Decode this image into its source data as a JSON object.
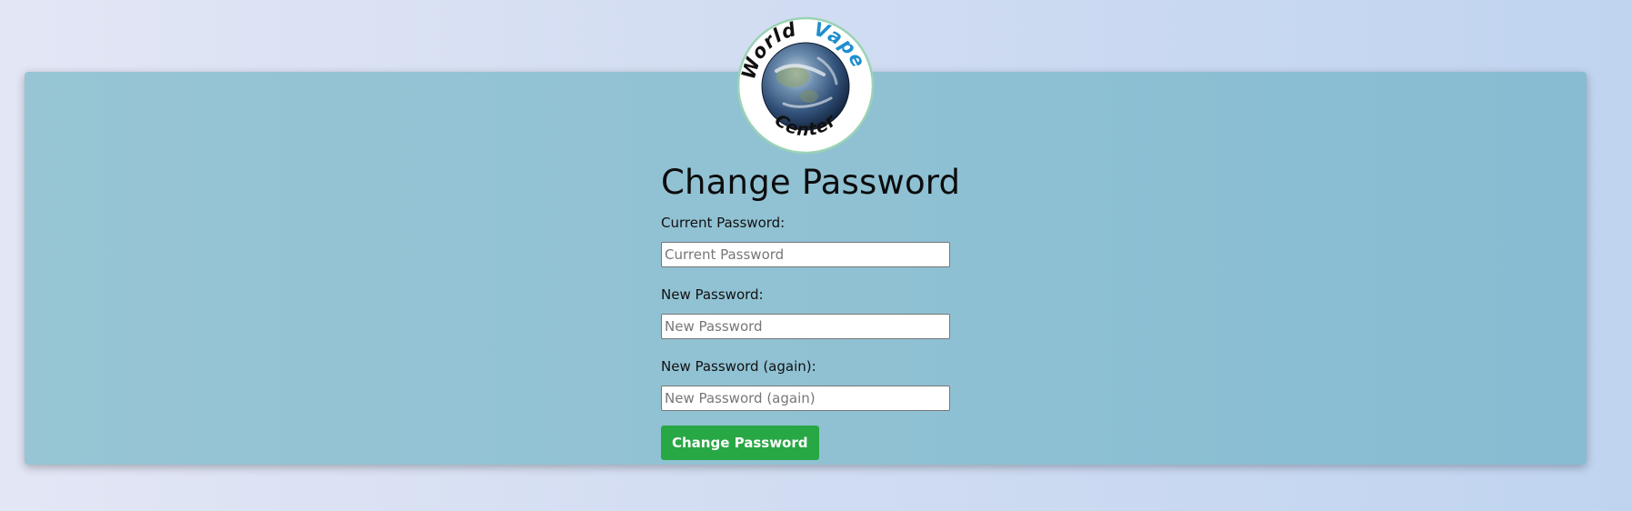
{
  "logo": {
    "word_1": "World",
    "word_2": "Vape",
    "word_3": "Center"
  },
  "form": {
    "title": "Change Password",
    "fields": [
      {
        "label": "Current Password:",
        "placeholder": "Current Password",
        "value": ""
      },
      {
        "label": "New Password:",
        "placeholder": "New Password",
        "value": ""
      },
      {
        "label": "New Password (again):",
        "placeholder": "New Password (again)",
        "value": ""
      }
    ],
    "submit_label": "Change Password"
  },
  "colors": {
    "panel_background": "#8fc1d3",
    "submit_button": "#28a745",
    "logo_accent": "#1e8fce"
  }
}
